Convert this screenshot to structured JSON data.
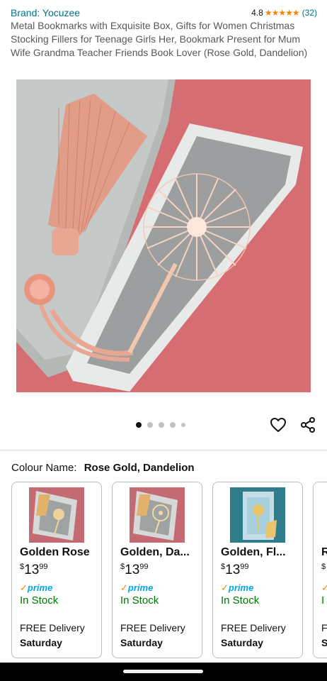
{
  "product": {
    "brand": "Brand: Yocuzee",
    "rating_value": "4.8",
    "rating_count": "(32)",
    "title": "Metal Bookmarks with Exquisite Box, Gifts for Women Christmas Stocking Fillers for Teenage Girls Her, Bookmark Present for Mum Wife Grandma Teacher Friends Book Lover (Rose Gold, Dandelion)"
  },
  "gallery": {
    "image_count": 5,
    "active_index": 0,
    "main_image_icon": "rose-gold-dandelion-bookmark-photo"
  },
  "actions": {
    "wishlist_icon": "heart-icon",
    "share_icon": "share-icon"
  },
  "colour": {
    "label": "Colour Name:",
    "value": "Rose Gold, Dandelion"
  },
  "variants": [
    {
      "name": "Golden Rose",
      "price_symbol": "$",
      "price_whole": "13",
      "price_cents": "99",
      "prime": "prime",
      "stock": "In Stock",
      "delivery": "FREE Delivery",
      "day": "Saturday"
    },
    {
      "name": "Golden, Da...",
      "price_symbol": "$",
      "price_whole": "13",
      "price_cents": "99",
      "prime": "prime",
      "stock": "In Stock",
      "delivery": "FREE Delivery",
      "day": "Saturday"
    },
    {
      "name": "Golden, Fl...",
      "price_symbol": "$",
      "price_whole": "13",
      "price_cents": "99",
      "prime": "prime",
      "stock": "In Stock",
      "delivery": "FREE Delivery",
      "day": "Saturday"
    },
    {
      "name": "R",
      "price_symbol": "$",
      "price_whole": "",
      "price_cents": "",
      "prime": "",
      "stock": "I",
      "delivery": "F",
      "day": "S"
    }
  ],
  "colors": {
    "link": "#007185",
    "star": "#f08804",
    "prime_blue": "#00a8e1",
    "in_stock": "#007600",
    "image_background": "#d66d73"
  }
}
